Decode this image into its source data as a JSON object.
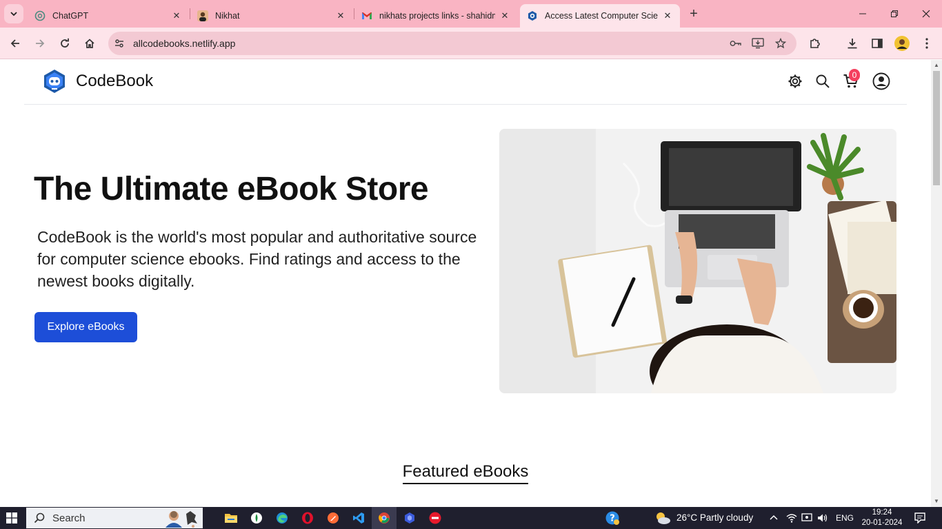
{
  "browser": {
    "tabs": [
      {
        "title": "ChatGPT",
        "icon": "chatgpt-icon",
        "active": false
      },
      {
        "title": "Nikhat",
        "icon": "avatar-icon",
        "active": false
      },
      {
        "title": "nikhats projects links - shahidm",
        "icon": "gmail-icon",
        "active": false
      },
      {
        "title": "Access Latest Computer Science",
        "icon": "codebook-icon",
        "active": true
      }
    ],
    "url": "allcodebooks.netlify.app"
  },
  "site": {
    "brand": "CodeBook",
    "cart_count": "0"
  },
  "hero": {
    "title": "The Ultimate eBook Store",
    "description": "CodeBook is the world's most popular and authoritative source for computer science ebooks. Find ratings and access to the newest books digitally.",
    "cta": "Explore eBooks"
  },
  "featured": {
    "heading": "Featured eBooks"
  },
  "taskbar": {
    "search_label": "Search",
    "weather": "26°C  Partly cloudy",
    "language": "ENG",
    "time": "19:24",
    "date": "20-01-2024"
  },
  "colors": {
    "tabstrip": "#f9b4c3",
    "toolbar": "#fde4ea",
    "primary_button": "#1d4ed8",
    "cart_badge": "#f43f5e",
    "taskbar": "#1f1f2e"
  }
}
